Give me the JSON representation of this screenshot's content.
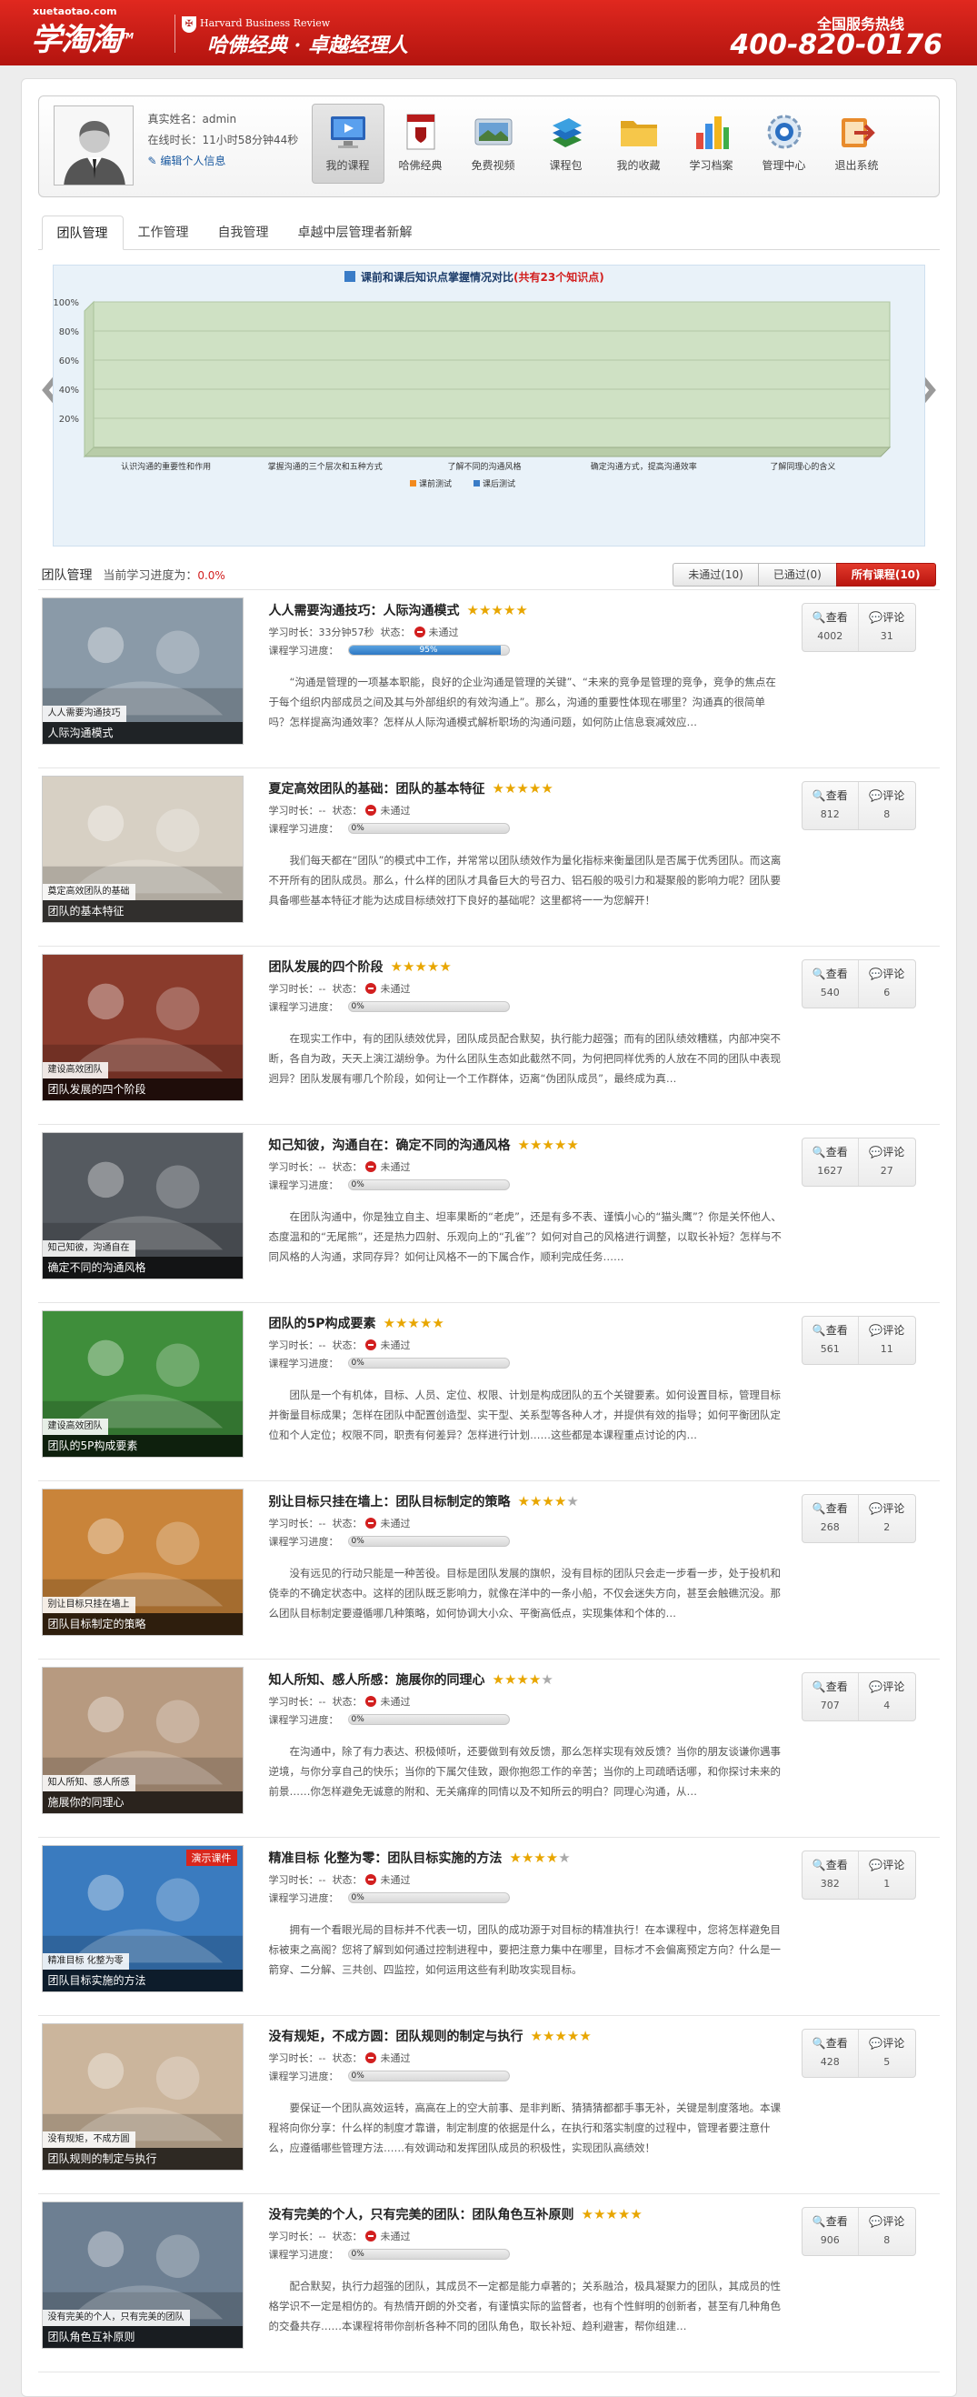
{
  "header": {
    "site_url": "xuetaotao.com",
    "logo_text": "学淘淘",
    "logo_tm": "TM",
    "partner_name": "Harvard Business Review",
    "partner_cn": "哈佛经典 · 卓越经理人",
    "hotline_label": "全国服务热线",
    "hotline_number": "400-820-0176"
  },
  "profile": {
    "real_name": "真实姓名：admin",
    "online_time": "在线时长：11小时58分钟44秒",
    "edit_label": "编辑个人信息"
  },
  "nav": [
    {
      "label": "我的课程",
      "icon": "monitor-icon"
    },
    {
      "label": "哈佛经典",
      "icon": "harvard-book-icon"
    },
    {
      "label": "免费视频",
      "icon": "video-icon"
    },
    {
      "label": "课程包",
      "icon": "books-icon"
    },
    {
      "label": "我的收藏",
      "icon": "folder-icon"
    },
    {
      "label": "学习档案",
      "icon": "bar-chart-icon"
    },
    {
      "label": "管理中心",
      "icon": "gear-icon"
    },
    {
      "label": "退出系统",
      "icon": "exit-icon"
    }
  ],
  "tabs": [
    "团队管理",
    "工作管理",
    "自我管理",
    "卓越中层管理者新解"
  ],
  "chart_data": {
    "type": "bar",
    "title": "课前和课后知识点掌握情况对比",
    "title_note": "(共有23个知识点)",
    "categories": [
      "认识沟通的重要性和作用",
      "掌握沟通的三个层次和五种方式",
      "了解不同的沟通风格",
      "确定沟通方式，提高沟通效率",
      "了解同理心的含义"
    ],
    "series": [
      {
        "name": "课前测试",
        "values": [
          0,
          0,
          0,
          0,
          0
        ]
      },
      {
        "name": "课后测试",
        "values": [
          0,
          0,
          0,
          0,
          0
        ]
      }
    ],
    "yticks": [
      "100%",
      "80%",
      "60%",
      "40%",
      "20%"
    ],
    "ylim": [
      0,
      100
    ],
    "colors": [
      "#f28a1e",
      "#3a7cc7"
    ],
    "legend_position": "bottom"
  },
  "filter": {
    "title": "团队管理",
    "progress_label": "当前学习进度为：",
    "progress_value": "0.0%",
    "buttons": [
      "未通过(10)",
      "已通过(0)",
      "所有课程(10)"
    ]
  },
  "labels": {
    "duration": "学习时长：",
    "status": "状态：",
    "status_value": "未通过",
    "progress": "课程学习进度：",
    "view": "查看",
    "comment": "评论"
  },
  "courses": [
    {
      "title": "人人需要沟通技巧：人际沟通模式",
      "stars": 4.5,
      "duration": "33分钟57秒",
      "progress_pct": 95,
      "progress_text": "95%",
      "views": "4002",
      "comments": "31",
      "desc": "“沟通是管理的一项基本职能，良好的企业沟通是管理的关键”、“未来的竞争是管理的竞争，竞争的焦点在于每个组织内部成员之间及其与外部组织的有效沟通上”。那么，沟通的重要性体现在哪里？沟通真的很简单吗？怎样提高沟通效率？怎样从人际沟通模式解析职场的沟通问题，如何防止信息衰减效应…",
      "thumb_sub": "人人需要沟通技巧",
      "thumb_caption": "人际沟通模式",
      "thumb_color": "#8a9aa8",
      "badge": ""
    },
    {
      "title": "夏定高效团队的基础：团队的基本特征",
      "stars": 5,
      "duration": "--",
      "progress_pct": 0,
      "progress_text": "0%",
      "views": "812",
      "comments": "8",
      "desc": "我们每天都在“团队”的模式中工作，并常常以团队绩效作为量化指标来衡量团队是否属于优秀团队。而这离不开所有的团队成员。那么，什么样的团队才具备巨大的号召力、铝石般的吸引力和凝聚般的影响力呢？团队要具备哪些基本特征才能为达成目标绩效打下良好的基础呢？这里都将一一为您解开！",
      "thumb_sub": "奠定高效团队的基础",
      "thumb_caption": "团队的基本特征",
      "thumb_color": "#d7d0c4",
      "badge": ""
    },
    {
      "title": "团队发展的四个阶段",
      "stars": 4.5,
      "duration": "--",
      "progress_pct": 0,
      "progress_text": "0%",
      "views": "540",
      "comments": "6",
      "desc": "在现实工作中，有的团队绩效优异，团队成员配合默契，执行能力超强；而有的团队绩效糟糕，内部冲突不断，各自为政，天天上演江湖纷争。为什么团队生态如此截然不同，为何把同样优秀的人放在不同的团队中表现迥异？团队发展有哪几个阶段，如何让一个工作群体，迈离“伪团队成员”，最终成为真…",
      "thumb_sub": "建设高效团队",
      "thumb_caption": "团队发展的四个阶段",
      "thumb_color": "#8a3b2c",
      "badge": ""
    },
    {
      "title": "知己知彼，沟通自在：确定不同的沟通风格",
      "stars": 5,
      "duration": "--",
      "progress_pct": 0,
      "progress_text": "0%",
      "views": "1627",
      "comments": "27",
      "desc": "在团队沟通中，你是独立自主、坦率果断的“老虎”，还是有多不表、谨慎小心的“猫头鹰”？你是关怀他人、态度温和的“无尾熊”，还是热力四射、乐观向上的“孔雀”？如何对自己的风格进行调整，以取长补短？怎样与不同风格的人沟通，求同存异？如何让风格不一的下属合作，顺利完成任务……",
      "thumb_sub": "知己知彼，沟通自在",
      "thumb_caption": "确定不同的沟通风格",
      "thumb_color": "#555a60",
      "badge": ""
    },
    {
      "title": "团队的5P构成要素",
      "stars": 4.5,
      "duration": "--",
      "progress_pct": 0,
      "progress_text": "0%",
      "views": "561",
      "comments": "11",
      "desc": "团队是一个有机体，目标、人员、定位、权限、计划是构成团队的五个关键要素。如何设置目标，管理目标并衡量目标成果；怎样在团队中配置创造型、实干型、关系型等各种人才，并提供有效的指导；如何平衡团队定位和个人定位；权限不同，职责有何差异？怎样进行计划……这些都是本课程重点讨论的内…",
      "thumb_sub": "建设高效团队",
      "thumb_caption": "团队的5P构成要素",
      "thumb_color": "#3f8e3b",
      "badge": ""
    },
    {
      "title": "别让目标只挂在墙上：团队目标制定的策略",
      "stars": 4,
      "duration": "--",
      "progress_pct": 0,
      "progress_text": "0%",
      "views": "268",
      "comments": "2",
      "desc": "没有远见的行动只能是一种苦役。目标是团队发展的旗帜，没有目标的团队只会走一步看一步，处于投机和侥幸的不确定状态中。这样的团队既乏影响力，就像在洋中的一条小船，不仅会迷失方向，甚至会触礁沉没。那么团队目标制定要遵循哪几种策略，如何协调大小众、平衡高低点，实现集体和个体的…",
      "thumb_sub": "别让目标只挂在墙上",
      "thumb_caption": "团队目标制定的策略",
      "thumb_color": "#c9843a",
      "badge": ""
    },
    {
      "title": "知人所知、感人所感：施展你的同理心",
      "stars": 4,
      "duration": "--",
      "progress_pct": 0,
      "progress_text": "0%",
      "views": "707",
      "comments": "4",
      "desc": "在沟通中，除了有力表达、积极倾听，还要做到有效反馈，那么怎样实现有效反馈？当你的朋友谈谦你遇事逆境，与你分享自己的快乐；当你的下属欠佳致，跟你抱怨工作的辛苦；当你的上司疏晒话哪，和你探讨未来的前景……你怎样避免无诚意的附和、无关痛痒的同情以及不知所云的明白？同理心沟通，从…",
      "thumb_sub": "知人所知、感人所感",
      "thumb_caption": "施展你的同理心",
      "thumb_color": "#b79a80",
      "badge": ""
    },
    {
      "title": "精准目标 化整为零：团队目标实施的方法",
      "stars": 4,
      "duration": "--",
      "progress_pct": 0,
      "progress_text": "0%",
      "views": "382",
      "comments": "1",
      "desc": "拥有一个看眼光局的目标并不代表一切，团队的成功源于对目标的精准执行！在本课程中，您将怎样避免目标被束之高阁？您将了解到如何通过控制进程中，要把注意力集中在哪里，目标才不会偏离预定方向？什么是一箭穿、二分解、三共创、四监控，如何运用这些有利助攻实现目标。",
      "thumb_sub": "精准目标 化整为零",
      "thumb_caption": "团队目标实施的方法",
      "thumb_color": "#3a7bbf",
      "badge": "演示课件"
    },
    {
      "title": "没有规矩，不成方圆：团队规则的制定与执行",
      "stars": 5,
      "duration": "--",
      "progress_pct": 0,
      "progress_text": "0%",
      "views": "428",
      "comments": "5",
      "desc": "要保证一个团队高效运转，高高在上的空大前事、是非判断、猜猜猜都都手事无补，关键是制度落地。本课程将向你分享：什么样的制度才靠谱，制定制度的依据是什么，在执行和落实制度的过程中，管理者要注意什么，应遵循哪些管理方法……有效调动和发挥团队成员的积极性，实现团队高绩效！",
      "thumb_sub": "没有规矩，不成方圆",
      "thumb_caption": "团队规则的制定与执行",
      "thumb_color": "#cbb59c",
      "badge": ""
    },
    {
      "title": "没有完美的个人，只有完美的团队：团队角色互补原则",
      "stars": 5,
      "duration": "--",
      "progress_pct": 0,
      "progress_text": "0%",
      "views": "906",
      "comments": "8",
      "desc": "配合默契，执行力超强的团队，其成员不一定都是能力卓著的；关系融洽，极具凝聚力的团队，其成员的性格学识不一定是相仿的。有热情开朗的外交者，有谨慎实际的监督者，也有个性鲜明的创新者，甚至有几种角色的交叠共存……本课程将带你剖析各种不同的团队角色，取长补短、趋利避害，帮你组建…",
      "thumb_sub": "没有完美的个人，只有完美的团队",
      "thumb_caption": "团队角色互补原则",
      "thumb_color": "#6d7f92",
      "badge": ""
    }
  ]
}
